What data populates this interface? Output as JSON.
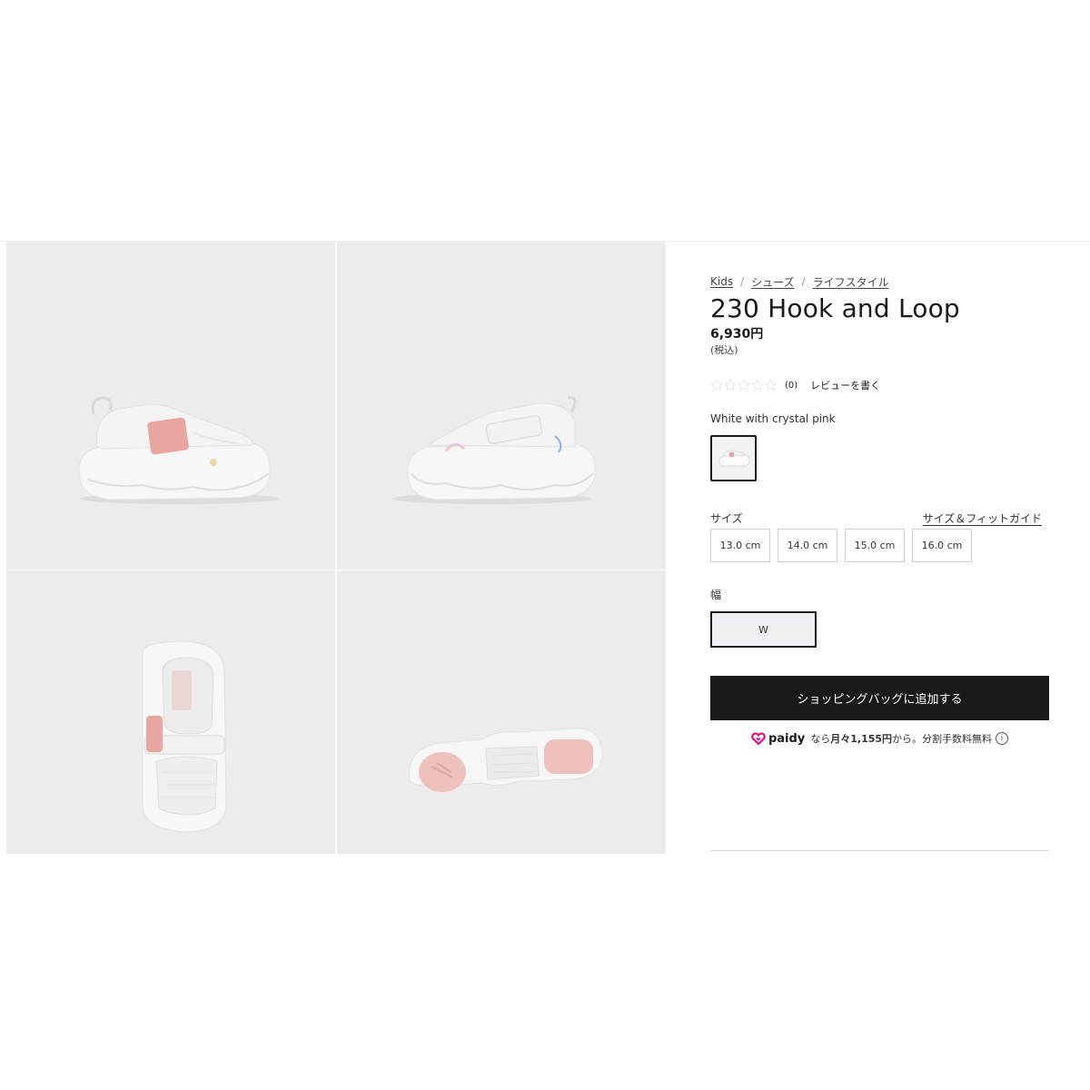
{
  "breadcrumb": {
    "items": [
      {
        "label": "Kids"
      },
      {
        "label": "シューズ"
      },
      {
        "label": "ライフスタイル"
      }
    ],
    "separator": "/"
  },
  "product": {
    "title": "230 Hook and Loop",
    "price": "6,930円",
    "tax_note": "(税込)"
  },
  "reviews": {
    "rating": 0,
    "max_rating": 5,
    "count_text": "(0)",
    "write_review_label": "レビューを書く"
  },
  "color": {
    "name": "White with crystal pink"
  },
  "sizes": {
    "label": "サイズ",
    "fit_guide_label": "サイズ＆フィットガイド",
    "options": [
      {
        "label": "13.0 cm"
      },
      {
        "label": "14.0 cm"
      },
      {
        "label": "15.0 cm"
      },
      {
        "label": "16.0 cm"
      }
    ]
  },
  "width": {
    "label": "幅",
    "selected": "W"
  },
  "cart": {
    "add_label": "ショッピングバッグに追加する"
  },
  "paidy": {
    "brand": "paidy",
    "prefix": "なら",
    "amount": "月々1,155円",
    "suffix": "から。分割手数料無料",
    "info": "i"
  },
  "colors": {
    "primary": "#1a1a1a",
    "tile_bg": "#ececed",
    "accent_pink": "#e8a9a4",
    "paidy_magenta": "#e5007f"
  }
}
